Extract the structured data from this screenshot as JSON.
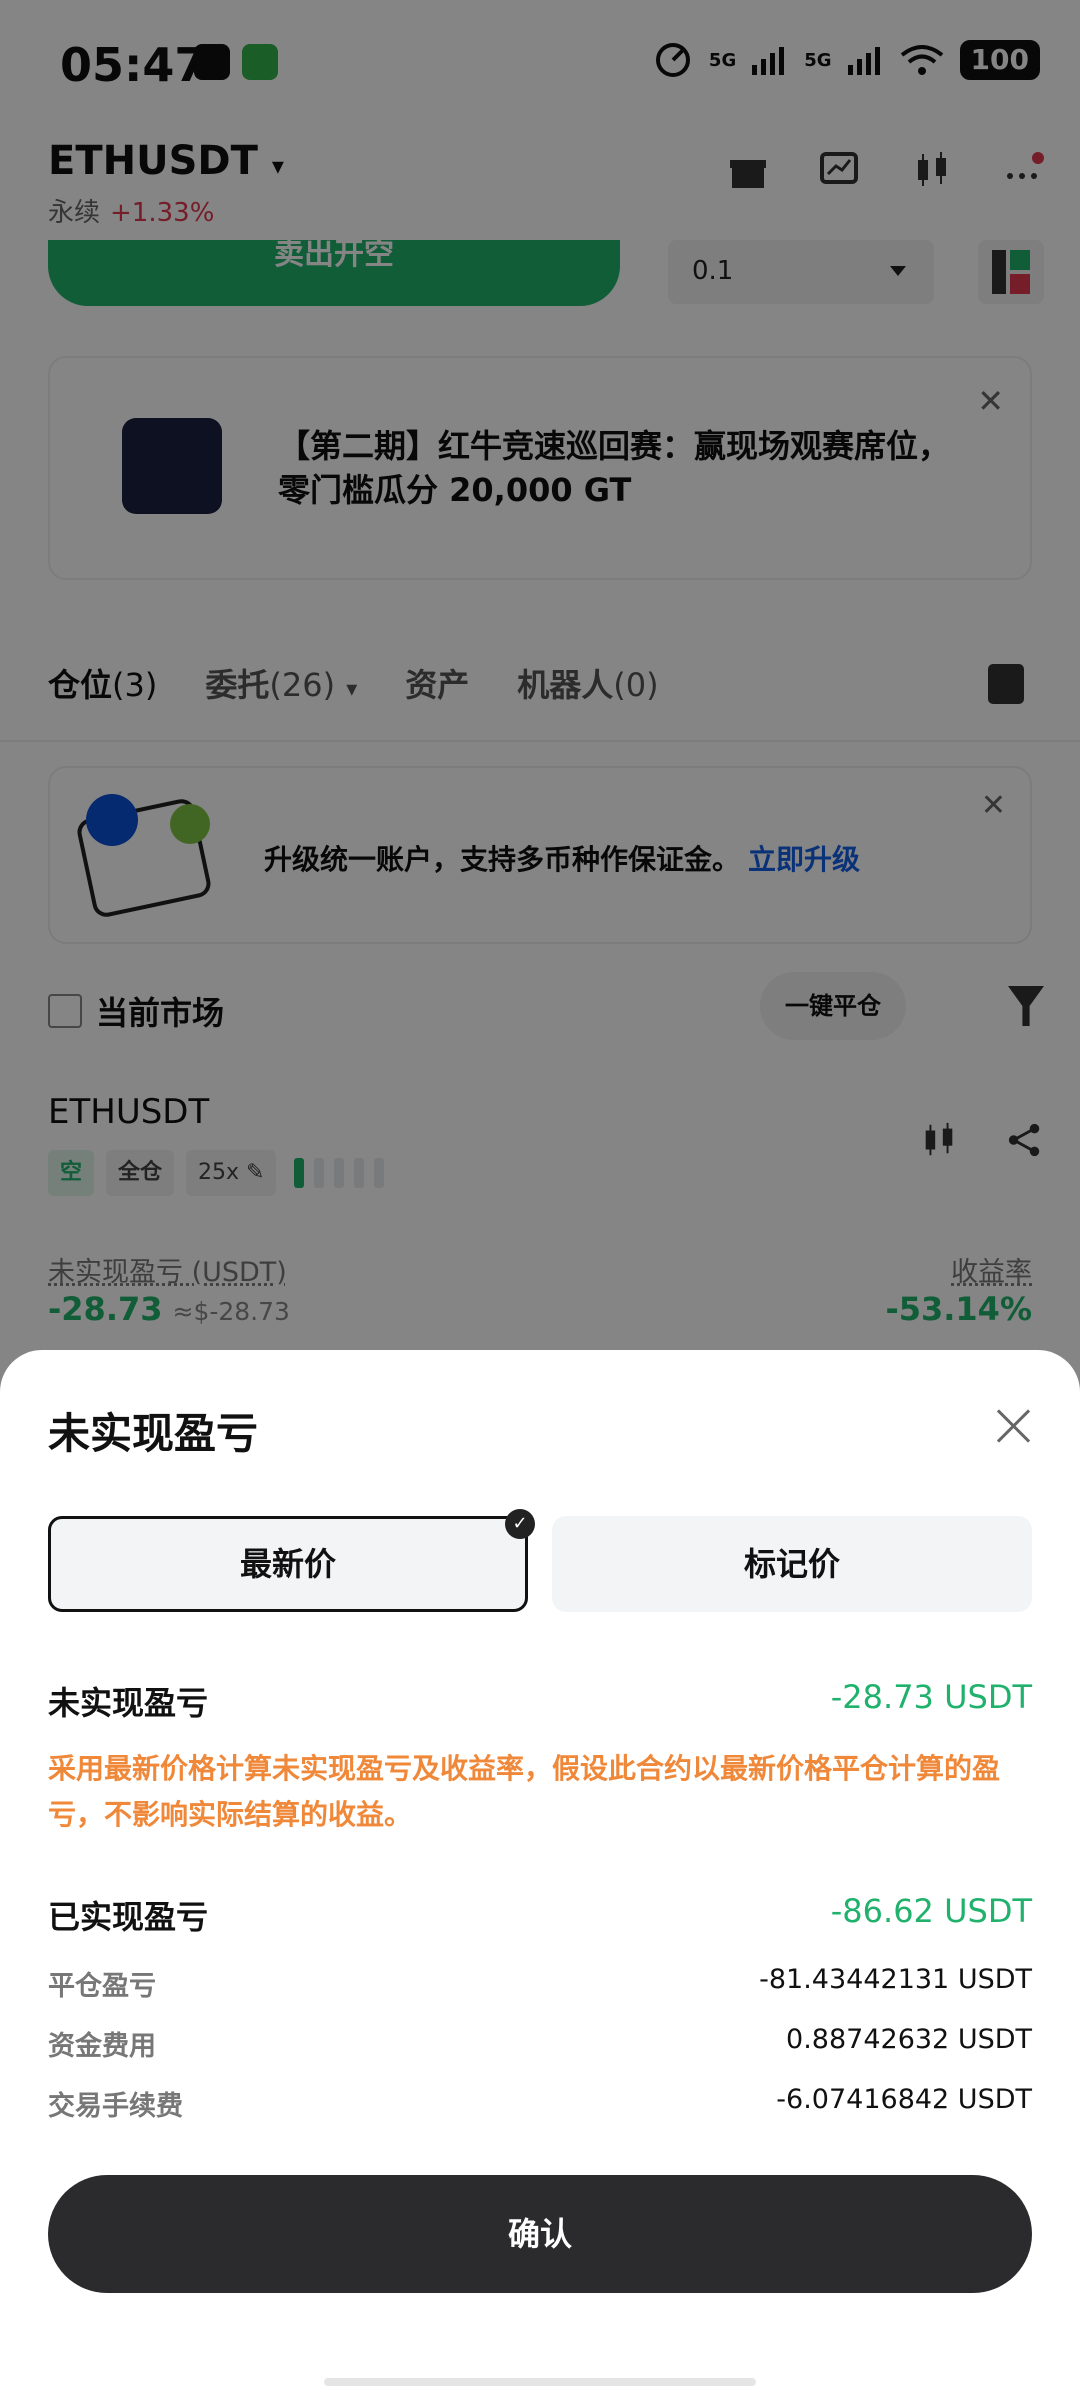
{
  "status": {
    "time": "05:47",
    "signal1": "5G",
    "signal2": "5G",
    "battery": "100"
  },
  "header": {
    "pair": "ETHUSDT",
    "type": "永续",
    "change": "+1.33%"
  },
  "trade": {
    "sell_label": "卖出开空",
    "qty": "0.1"
  },
  "banner": {
    "text": "【第二期】红牛竞速巡回赛：赢现场观赛席位，零门槛瓜分 20,000 GT"
  },
  "tabs": [
    {
      "label": "仓位",
      "count": "(3)"
    },
    {
      "label": "委托",
      "count": "(26)"
    },
    {
      "label": "资产",
      "count": ""
    },
    {
      "label": "机器人",
      "count": "(0)"
    }
  ],
  "promo": {
    "text": "升级统一账户，支持多币种作保证金。",
    "link": "立即升级"
  },
  "filters": {
    "current_market": "当前市场",
    "close_all": "一键平仓"
  },
  "position": {
    "symbol": "ETHUSDT",
    "side": "空",
    "margin_mode": "全仓",
    "leverage": "25x",
    "risk_level": 1,
    "upl_label": "未实现盈亏 (USDT)",
    "upl_value": "-28.73",
    "upl_approx": "≈$-28.73",
    "roe_label": "收益率",
    "roe_value": "-53.14%"
  },
  "sheet": {
    "title": "未实现盈亏",
    "seg_left": "最新价",
    "seg_right": "标记价",
    "unrealized_label": "未实现盈亏",
    "unrealized_value": "-28.73 USDT",
    "note": "采用最新价格计算未实现盈亏及收益率，假设此合约以最新价格平仓计算的盈亏，不影响实际结算的收益。",
    "realized_label": "已实现盈亏",
    "realized_value": "-86.62 USDT",
    "details": [
      {
        "label": "平仓盈亏",
        "value": "-81.43442131 USDT"
      },
      {
        "label": "资金费用",
        "value": "0.88742632 USDT"
      },
      {
        "label": "交易手续费",
        "value": "-6.07416842 USDT"
      }
    ],
    "confirm": "确认"
  },
  "colors": {
    "green": "#20b26c",
    "red": "#e0394f",
    "orange": "#f0883a",
    "link": "#1560e8"
  }
}
